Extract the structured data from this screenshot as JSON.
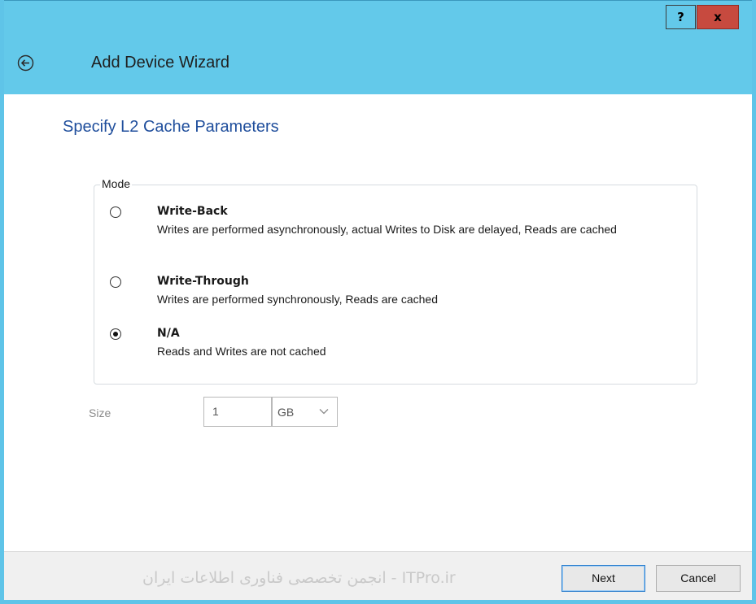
{
  "titlebar": {
    "help_label": "?",
    "close_label": "x"
  },
  "header": {
    "title": "Add Device Wizard",
    "back_icon": "back-arrow-circle-icon"
  },
  "page": {
    "title": "Specify L2 Cache Parameters"
  },
  "mode": {
    "legend": "Mode",
    "selected": "N/A",
    "options": [
      {
        "title": "Write-Back",
        "description": "Writes are performed asynchronously, actual Writes to Disk are delayed, Reads are cached",
        "checked": false
      },
      {
        "title": "Write-Through",
        "description": "Writes are performed synchronously, Reads are cached",
        "checked": false
      },
      {
        "title": "N/A",
        "description": "Reads and Writes are not cached",
        "checked": true
      }
    ]
  },
  "size": {
    "label": "Size",
    "value": "1",
    "unit": "GB"
  },
  "footer": {
    "watermark": "ITPro.ir - انجمن تخصصی فناوری اطلاعات ایران",
    "next_label": "Next",
    "cancel_label": "Cancel"
  },
  "colors": {
    "titlebar_bg": "#63c9ea",
    "page_title": "#1f4e9c",
    "close_button": "#c74a3f",
    "default_button_border": "#2c7ecd"
  }
}
